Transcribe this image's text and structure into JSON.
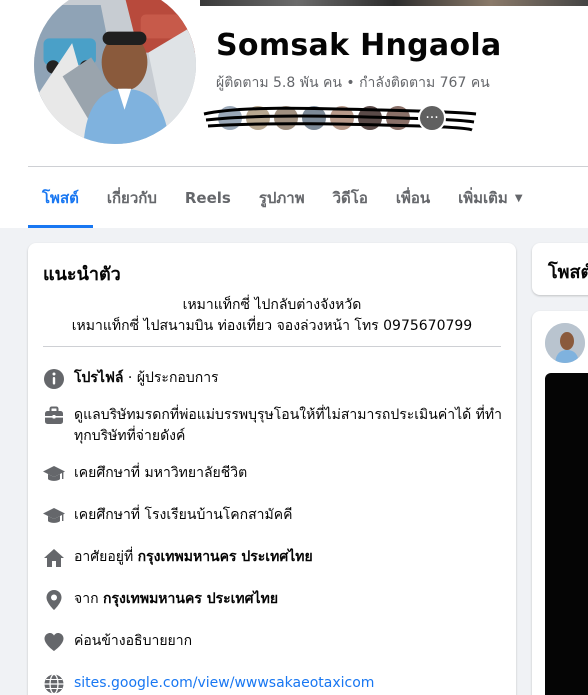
{
  "profile": {
    "name": "Somsak Hngaola",
    "followers_text": "ผู้ติดตาม 5.8 พัน คน • กำลังติดตาม 767 คน"
  },
  "tabs": [
    {
      "label": "โพสต์",
      "active": true
    },
    {
      "label": "เกี่ยวกับ"
    },
    {
      "label": "Reels"
    },
    {
      "label": "รูปภาพ"
    },
    {
      "label": "วิดีโอ"
    },
    {
      "label": "เพื่อน"
    },
    {
      "label": "เพิ่มเติม"
    }
  ],
  "intro": {
    "title": "แนะนำตัว",
    "bio_line1": "เหมาแท็กซี่ ไปกลับต่างจังหวัด",
    "bio_line2": "เหมาแท็กซี่ ไปสนามบิน ท่องเที่ยว จองล่วงหน้า โทร 0975670799",
    "profile_label": "โปรไฟล์",
    "profile_type": " · ผู้ประกอบการ",
    "work": "ดูแลบริษัทมรดกที่พ่อแม่บรรพบุรุษโอนให้ที่ไม่สามารถประเมินค่าได้ ที่ทำทุกบริษัทที่จ่ายดังค์",
    "edu1_prefix": "เคยศึกษาที่ ",
    "edu1": "มหาวิทยาลัยชีวิต",
    "edu2_prefix": "เคยศึกษาที่ ",
    "edu2": "โรงเรียนบ้านโคกสามัคคี",
    "lives_prefix": "อาศัยอยู่ที่ ",
    "lives": "กรุงเทพมหานคร ประเทศไทย",
    "from_prefix": "จาก ",
    "from": "กรุงเทพมหานคร ประเทศไทย",
    "relationship": "ค่อนข้างอธิบายยาก",
    "website": "sites.google.com/view/wwwsakaeotaxicom"
  },
  "posts": {
    "title": "โพสต์"
  },
  "colors": {
    "accent": "#1877f2",
    "secondary_text": "#65676b",
    "icon": "#65676b"
  }
}
